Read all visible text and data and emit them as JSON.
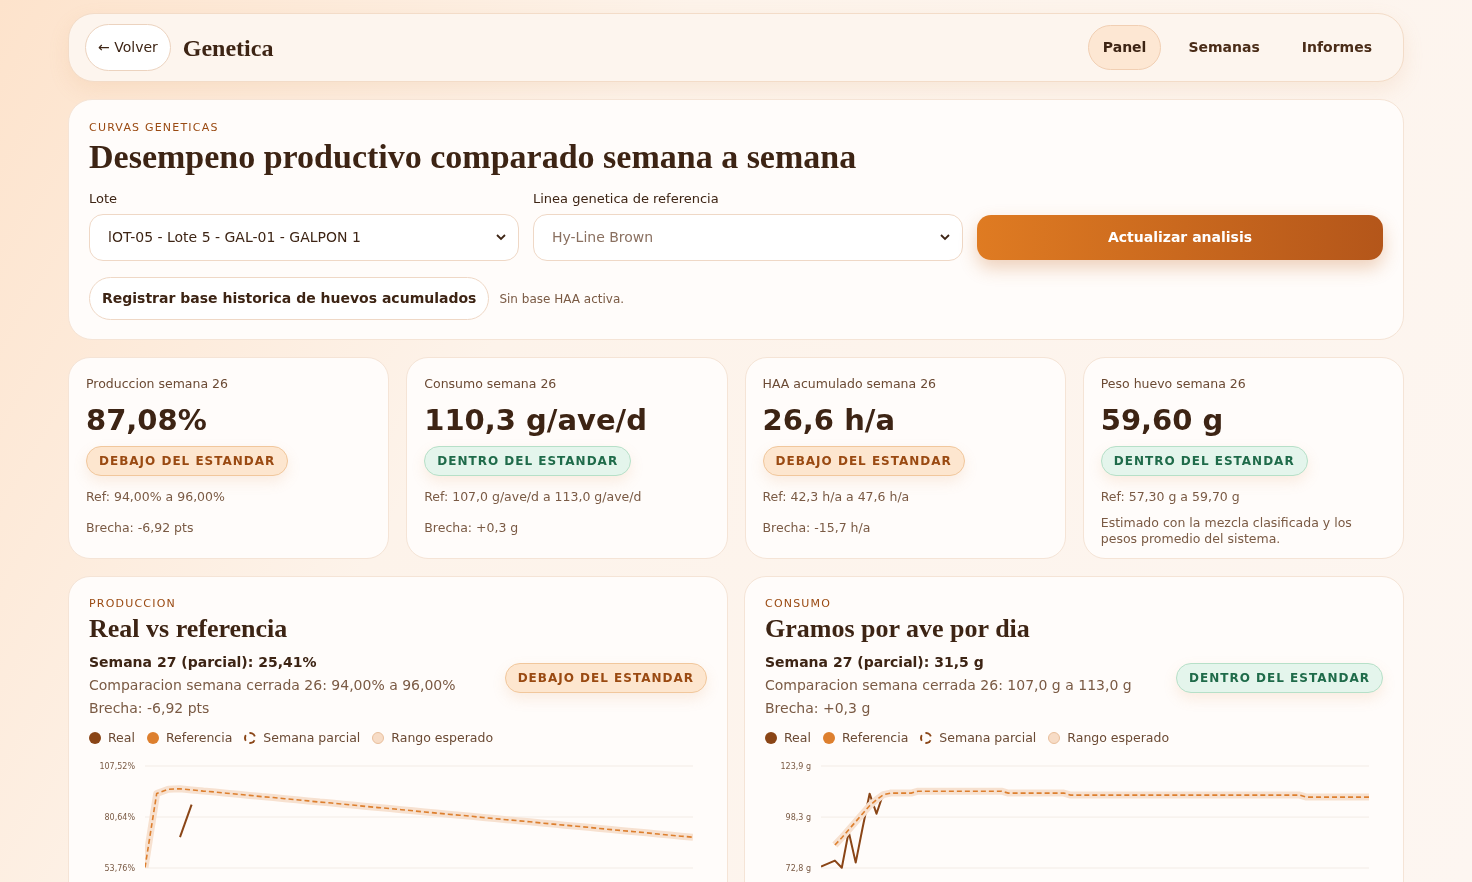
{
  "header": {
    "back_label": "← Volver",
    "title": "Genetica",
    "nav": [
      {
        "label": "Panel",
        "selected": true
      },
      {
        "label": "Semanas",
        "selected": false
      },
      {
        "label": "Informes",
        "selected": false
      }
    ]
  },
  "hero": {
    "kicker": "CURVAS GENETICAS",
    "title": "Desempeno productivo comparado semana a semana",
    "fields": [
      {
        "label": "Lote",
        "value": "lOT-05 - Lote 5 - GAL-01 - GALPON 1",
        "dimmed": false
      },
      {
        "label": "Linea genetica de referencia",
        "value": "Hy-Line Brown",
        "dimmed": true
      }
    ],
    "primary_button": "Actualizar analisis",
    "secondary_button": "Registrar base historica de huevos acumulados",
    "note": "Sin base HAA activa."
  },
  "kpis": [
    {
      "label": "Produccion semana 26",
      "value": "87,08%",
      "kind": "below",
      "badge": "DEBAJO DEL ESTANDAR",
      "lines": [
        "Ref: 94,00% a 96,00%",
        "Brecha: -6,92 pts"
      ]
    },
    {
      "label": "Consumo semana 26",
      "value": "110,3 g/ave/d",
      "kind": "within",
      "badge": "DENTRO DEL ESTANDAR",
      "lines": [
        "Ref: 107,0 g/ave/d a 113,0 g/ave/d",
        "Brecha: +0,3 g"
      ]
    },
    {
      "label": "HAA acumulado semana 26",
      "value": "26,6 h/a",
      "kind": "below",
      "badge": "DEBAJO DEL ESTANDAR",
      "lines": [
        "Ref: 42,3 h/a a 47,6 h/a",
        "Brecha: -15,7 h/a"
      ]
    },
    {
      "label": "Peso huevo semana 26",
      "value": "59,60 g",
      "kind": "within",
      "badge": "DENTRO DEL ESTANDAR",
      "lines": [
        "Ref: 57,30 g a 59,70 g"
      ],
      "note": "Estimado con la mezcla clasificada y los pesos promedio del sistema."
    }
  ],
  "charts": [
    {
      "kicker": "PRODUCCION",
      "title": "Real vs referencia",
      "summary": "Semana 27 (parcial): 25,41%",
      "comparison": "Comparacion semana cerrada 26: 94,00% a 96,00%",
      "gap": "Brecha: -6,92 pts",
      "kind": "below",
      "badge": "DEBAJO DEL ESTANDAR",
      "legend_extra": [
        {
          "label": "Semana parcial",
          "kind": "dashed-ring",
          "color": "#8a4516"
        },
        {
          "label": "Rango esperado",
          "kind": "ring",
          "color": "#f7dcc6"
        }
      ],
      "chart_data": {
        "type": "line",
        "ylim": [
          53.76,
          107.52
        ],
        "yticks": [
          {
            "value": 107.52,
            "label": "107,52%"
          },
          {
            "value": 80.64,
            "label": "80,64%"
          },
          {
            "value": 53.76,
            "label": "53,76%"
          }
        ],
        "categories": [
          null,
          null,
          null,
          null,
          null,
          null,
          null,
          null,
          null,
          null,
          null,
          null,
          null,
          null,
          null,
          null,
          null,
          null,
          null,
          null,
          null,
          null,
          null,
          null,
          null,
          null,
          null,
          null,
          null,
          null,
          null,
          null,
          null,
          null,
          null,
          null,
          null,
          null,
          null,
          null,
          null,
          null,
          null,
          null,
          null,
          null,
          null,
          null
        ],
        "series": [
          {
            "name": "Real",
            "color": "#8a4516",
            "line_style": "solid",
            "values": [
              null,
              null,
              null,
              70,
              87.1,
              null,
              null,
              null,
              null,
              null,
              null,
              null,
              null,
              null,
              null,
              null,
              null,
              null,
              null,
              null,
              null,
              null,
              null,
              null,
              null,
              null,
              null,
              null,
              null,
              null,
              null,
              null,
              null,
              null,
              null,
              null,
              null,
              null,
              null,
              null,
              null,
              null,
              null,
              null,
              null,
              null,
              null,
              null
            ]
          },
          {
            "name": "Referencia",
            "color": "#dd7f2e",
            "line_style": "dashed",
            "values": [
              54,
              93,
              95.3,
              95.5,
              94.9,
              94.3,
              93.8,
              93.2,
              92.6,
              92.0,
              91.4,
              90.9,
              90.3,
              89.7,
              89.1,
              88.5,
              88.0,
              87.4,
              86.8,
              86.2,
              85.6,
              85.1,
              84.5,
              83.9,
              83.3,
              82.7,
              82.1,
              81.6,
              81.0,
              80.4,
              79.8,
              79.2,
              78.7,
              78.1,
              77.5,
              76.9,
              76.3,
              75.8,
              75.2,
              74.6,
              74.0,
              73.4,
              72.9,
              72.3,
              71.7,
              71.1,
              70.5,
              70.0
            ]
          }
        ]
      }
    },
    {
      "kicker": "CONSUMO",
      "title": "Gramos por ave por dia",
      "summary": "Semana 27 (parcial): 31,5 g",
      "comparison": "Comparacion semana cerrada 26: 107,0 g a 113,0 g",
      "gap": "Brecha: +0,3 g",
      "kind": "within",
      "badge": "DENTRO DEL ESTANDAR",
      "legend_extra": [
        {
          "label": "Semana parcial",
          "kind": "dashed-ring",
          "color": "#8a4516"
        },
        {
          "label": "Rango esperado",
          "kind": "ring",
          "color": "#f7dcc6"
        }
      ],
      "chart_data": {
        "type": "line",
        "ylim": [
          72.8,
          123.9
        ],
        "yticks": [
          {
            "value": 123.9,
            "label": "123,9 g"
          },
          {
            "value": 98.3,
            "label": "98,3 g"
          },
          {
            "value": 72.8,
            "label": "72,8 g"
          }
        ],
        "categories": [
          null,
          null,
          null,
          null,
          null,
          null,
          null,
          null,
          null,
          null,
          null,
          null,
          null,
          null,
          null,
          null,
          null,
          null,
          null,
          null,
          null,
          null,
          null,
          null,
          null,
          null,
          null,
          null,
          null,
          null,
          null,
          null,
          null,
          null,
          null,
          null,
          null,
          null,
          null,
          null,
          null,
          null,
          null,
          null,
          null,
          null,
          null,
          null,
          null,
          null,
          null,
          null,
          null,
          null,
          null,
          null,
          null,
          null,
          null,
          null,
          null,
          null,
          null,
          null,
          null,
          null,
          null,
          null,
          null,
          null,
          null,
          null,
          null,
          null,
          null,
          null,
          null,
          null,
          null,
          null
        ],
        "series": [
          {
            "name": "Real",
            "color": "#8a4516",
            "line_style": "solid",
            "values": [
              73.5,
              75,
              76.5,
              72.9,
              91,
              75.5,
              93,
              110,
              100,
              110.3,
              null,
              null,
              null,
              null,
              null,
              null,
              null,
              null,
              null,
              null,
              null,
              null,
              null,
              null,
              null,
              null,
              null,
              null,
              null,
              null,
              null,
              null,
              null,
              null,
              null,
              null,
              null,
              null,
              null,
              null,
              null,
              null,
              null,
              null,
              null,
              null,
              null,
              null,
              null,
              null,
              null,
              null,
              null,
              null,
              null,
              null,
              null,
              null,
              null,
              null,
              null,
              null,
              null,
              null,
              null,
              null,
              null,
              null,
              null,
              null,
              null,
              null,
              null,
              null,
              null,
              null,
              null,
              null,
              null,
              null
            ]
          },
          {
            "name": "Referencia",
            "color": "#dd7f2e",
            "line_style": "dashed",
            "values": [
              null,
              null,
              84.3,
              88,
              92,
              96,
              100,
              104,
              107,
              109.5,
              110.3,
              110.3,
              110.3,
              110.3,
              111.3,
              111.3,
              111.3,
              111.3,
              111.3,
              111.3,
              111.3,
              111.3,
              111.3,
              111.3,
              111.3,
              111.3,
              111.3,
              110.3,
              110.3,
              110.3,
              110.3,
              110.3,
              110.3,
              110.3,
              110.3,
              110.3,
              109.3,
              109.3,
              109.3,
              109.3,
              109.3,
              109.3,
              109.3,
              109.3,
              109.3,
              109.3,
              109.3,
              109.3,
              109.3,
              109.3,
              109.3,
              109.3,
              109.3,
              109.3,
              109.3,
              109.3,
              109.3,
              109.3,
              109.3,
              109.3,
              109.3,
              109.3,
              109.3,
              109.3,
              109.3,
              109.3,
              109.3,
              109.3,
              109.3,
              109.3,
              108.3,
              108.3,
              108.3,
              108.3,
              108.3,
              108.3,
              108.3,
              108.3,
              108.3,
              108.3
            ]
          }
        ]
      }
    }
  ]
}
